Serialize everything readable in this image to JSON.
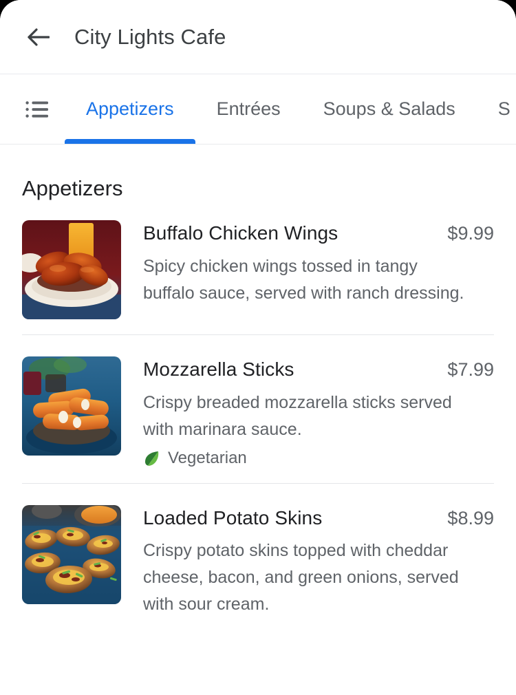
{
  "appbar": {
    "back_icon": "arrow-back-icon",
    "title": "City Lights Cafe"
  },
  "tabbar": {
    "list_icon": "list-bulleted-icon",
    "active_index": 0,
    "accent_color": "#1a73e8",
    "inactive_color": "#5f6368",
    "tabs": [
      {
        "label": "Appetizers"
      },
      {
        "label": "Entrées"
      },
      {
        "label": "Soups & Salads"
      },
      {
        "label": "S"
      }
    ]
  },
  "section": {
    "title": "Appetizers"
  },
  "menu_items": [
    {
      "name": "Buffalo Chicken Wings",
      "price": "$9.99",
      "description": "Spicy chicken wings tossed in tangy buffalo sauce, served with ranch dressing.",
      "image_alt": "buffalo-chicken-wings-photo",
      "badges": []
    },
    {
      "name": "Mozzarella Sticks",
      "price": "$7.99",
      "description": "Crispy breaded mozzarella sticks served with marinara sauce.",
      "image_alt": "mozzarella-sticks-photo",
      "badges": [
        {
          "label": "Vegetarian",
          "icon": "leaf-icon",
          "color": "#34a853"
        }
      ]
    },
    {
      "name": "Loaded Potato Skins",
      "price": "$8.99",
      "description": "Crispy potato skins topped with cheddar cheese, bacon, and green onions, served with sour cream.",
      "image_alt": "loaded-potato-skins-photo",
      "badges": []
    }
  ]
}
